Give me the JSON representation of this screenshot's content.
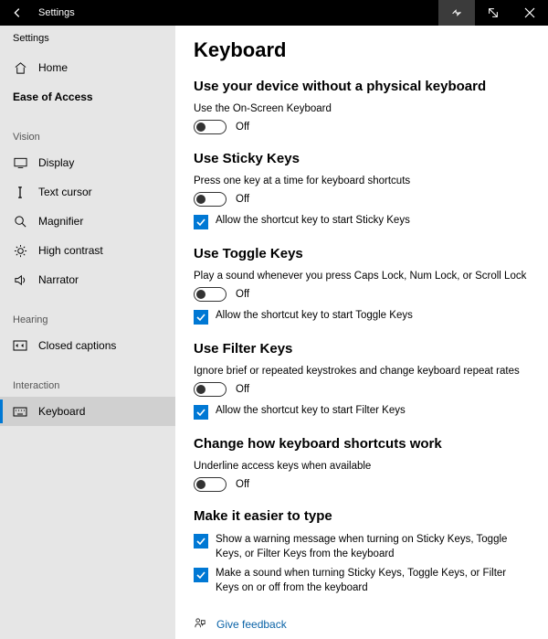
{
  "titlebar": {
    "title": "Settings"
  },
  "app_label": "Settings",
  "nav": {
    "home": "Home",
    "ease_of_access": "Ease of Access",
    "groups": {
      "vision": "Vision",
      "hearing": "Hearing",
      "interaction": "Interaction"
    },
    "items": {
      "display": "Display",
      "text_cursor": "Text cursor",
      "magnifier": "Magnifier",
      "high_contrast": "High contrast",
      "narrator": "Narrator",
      "closed_captions": "Closed captions",
      "keyboard": "Keyboard"
    }
  },
  "page": {
    "title": "Keyboard",
    "osk": {
      "heading": "Use your device without a physical keyboard",
      "desc": "Use the On-Screen Keyboard",
      "toggle_state": "Off"
    },
    "sticky": {
      "heading": "Use Sticky Keys",
      "desc": "Press one key at a time for keyboard shortcuts",
      "toggle_state": "Off",
      "check": "Allow the shortcut key to start Sticky Keys"
    },
    "toggle_keys": {
      "heading": "Use Toggle Keys",
      "desc": "Play a sound whenever you press Caps Lock, Num Lock, or Scroll Lock",
      "toggle_state": "Off",
      "check": "Allow the shortcut key to start Toggle Keys"
    },
    "filter": {
      "heading": "Use Filter Keys",
      "desc": "Ignore brief or repeated keystrokes and change keyboard repeat rates",
      "toggle_state": "Off",
      "check": "Allow the shortcut key to start Filter Keys"
    },
    "shortcuts": {
      "heading": "Change how keyboard shortcuts work",
      "desc": "Underline access keys when available",
      "toggle_state": "Off"
    },
    "easier": {
      "heading": "Make it easier to type",
      "check1": "Show a warning message when turning on Sticky Keys, Toggle Keys, or Filter Keys from the keyboard",
      "check2": "Make a sound when turning Sticky Keys, Toggle Keys, or Filter Keys on or off from the keyboard"
    },
    "feedback": "Give feedback"
  }
}
